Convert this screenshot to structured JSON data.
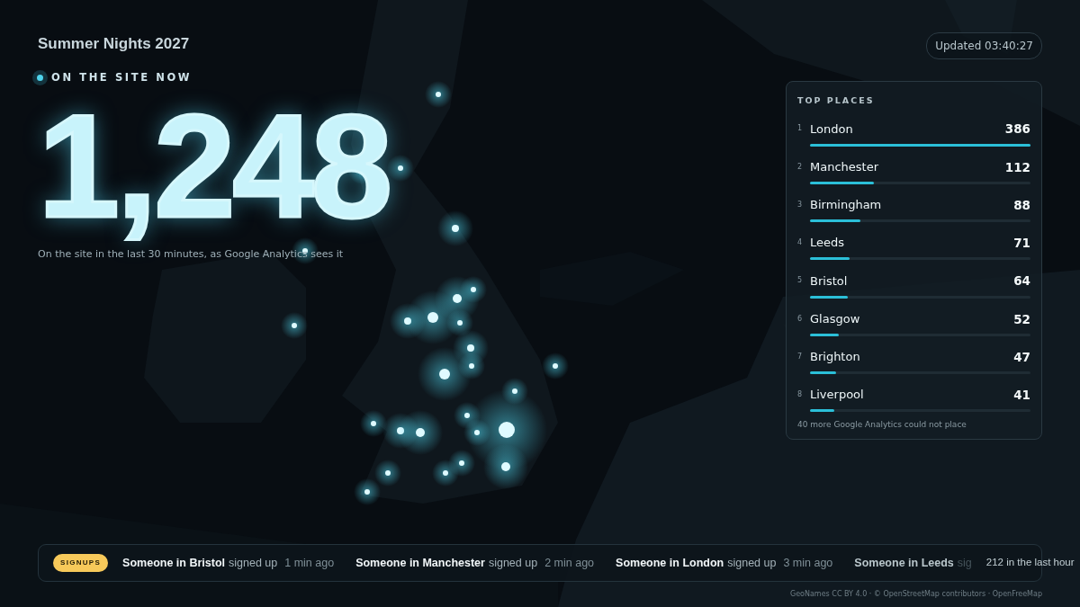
{
  "title": "Summer Nights 2027",
  "updated": "Updated 03:40:27",
  "live": {
    "label": "ON THE SITE NOW",
    "on": true,
    "count": "1,248",
    "caption": "On the site in the last 30 minutes, as Google Analytics sees it"
  },
  "top_places": {
    "title": "TOP PLACES",
    "rows": [
      {
        "rank": "1",
        "name": "London",
        "count": "386",
        "level": 1.0
      },
      {
        "rank": "2",
        "name": "Manchester",
        "count": "112",
        "level": 0.29
      },
      {
        "rank": "3",
        "name": "Birmingham",
        "count": "88",
        "level": 0.23
      },
      {
        "rank": "4",
        "name": "Leeds",
        "count": "71",
        "level": 0.18
      },
      {
        "rank": "5",
        "name": "Bristol",
        "count": "64",
        "level": 0.17
      },
      {
        "rank": "6",
        "name": "Glasgow",
        "count": "52",
        "level": 0.13
      },
      {
        "rank": "7",
        "name": "Brighton",
        "count": "47",
        "level": 0.12
      },
      {
        "rank": "8",
        "name": "Liverpool",
        "count": "41",
        "level": 0.11
      }
    ],
    "footnote": "40 more Google Analytics could not place"
  },
  "ticker": {
    "badge": "SIGNUPS",
    "items": [
      {
        "who": "Someone in Bristol",
        "action": "signed up",
        "time": "1 min ago"
      },
      {
        "who": "Someone in Manchester",
        "action": "signed up",
        "time": "2 min ago"
      },
      {
        "who": "Someone in London",
        "action": "signed up",
        "time": "3 min ago"
      },
      {
        "who": "Someone in Leeds",
        "action": "sig"
      }
    ],
    "total": "212 in the last hour"
  },
  "attribution": "GeoNames CC BY 4.0 · © OpenStreetMap contributors · OpenFreeMap"
}
